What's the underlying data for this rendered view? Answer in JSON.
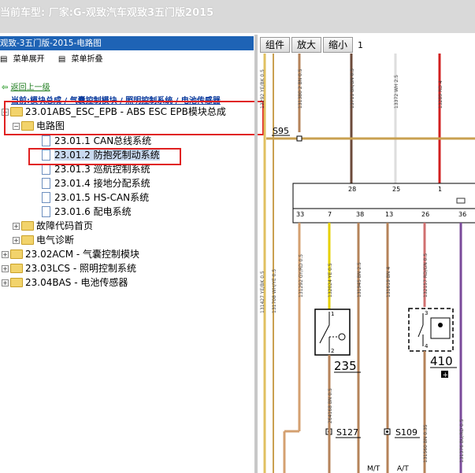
{
  "window": {
    "title": "当前车型:  厂家:G-观致汽车观致3五门版2015"
  },
  "left_panel": {
    "header": "观致-3五门版-2015-电路图",
    "toolbar": {
      "expand": "菜单展开",
      "collapse": "菜单折叠"
    },
    "back_link": "返回上一级",
    "breadcrumb": "当前:模块总成 / 气囊控制模块 / 照明控制系统 / 电池传感器",
    "tree": [
      {
        "label": "23.01ABS_ESC_EPB - ABS ESC EPB模块总成"
      },
      {
        "label": "电路图"
      },
      {
        "label": "23.01.1 CAN总线系统"
      },
      {
        "label": "23.01.2 防抱死制动系统"
      },
      {
        "label": "23.01.3 巡航控制系统"
      },
      {
        "label": "23.01.4 接地分配系统"
      },
      {
        "label": "23.01.5 HS-CAN系统"
      },
      {
        "label": "23.01.6 配电系统"
      },
      {
        "label": "故障代码首页"
      },
      {
        "label": "电气诊断"
      },
      {
        "label": "23.02ACM - 气囊控制模块"
      },
      {
        "label": "23.03LCS - 照明控制系统"
      },
      {
        "label": "23.04BAS - 电池传感器"
      }
    ]
  },
  "diagram": {
    "toolbar": {
      "btn1": "组件",
      "btn2": "放大",
      "btn3": "缩小",
      "page": "1"
    },
    "splice_top": "S95",
    "pins_top": [
      "28",
      "25",
      "1"
    ],
    "pins_bottom": [
      "33",
      "7",
      "38",
      "13",
      "26",
      "36"
    ],
    "component_left": "235",
    "component_right": "410",
    "splices_bottom": [
      "S127",
      "S109"
    ],
    "bottom_labels": [
      "M/T",
      "A/T"
    ],
    "wire_labels": {
      "w1": "13292 YE/BK 0.5",
      "w2": "131380 2 BN 0.5",
      "w3": "13711 BK/BN 0.5",
      "w4": "13372 WH 2.5",
      "w5": "13289 RD 4",
      "w6": "131427 YE/BK 0.5",
      "w7": "131708 WH/YE 0.5",
      "w8": "131292 GY/RD 0.5",
      "w9": "132024 YE 0.5",
      "w10": "131945 BN 2.5",
      "w11": "131619 BN 4",
      "w12": "132157 RD/GN 0.5",
      "w13": "264168 BN 0.5",
      "w14": "131560 BN 0.35",
      "w15": "131376 BU/RD 0.5"
    }
  }
}
